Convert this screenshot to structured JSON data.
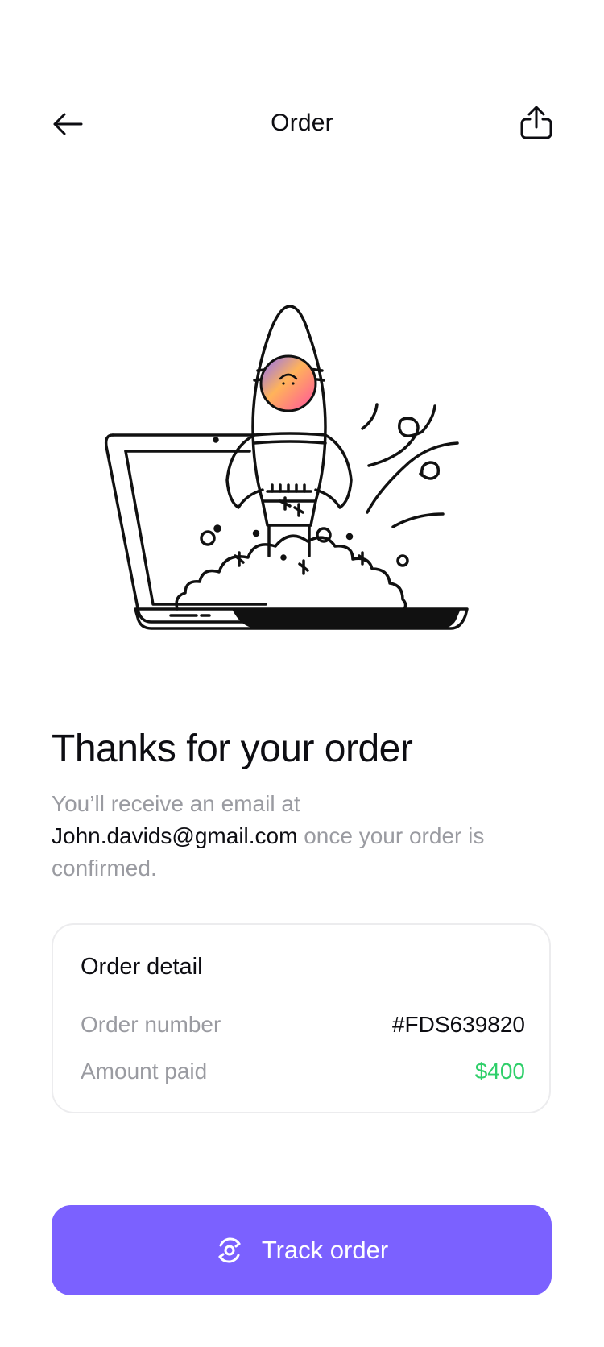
{
  "header": {
    "title": "Order",
    "back_icon": "arrow-left-icon",
    "share_icon": "share-icon"
  },
  "illustration": {
    "name": "rocket-launch-illustration"
  },
  "confirmation": {
    "heading": "Thanks for your order",
    "message_before": "You’ll receive an email at",
    "email": "John.davids@gmail.com",
    "message_after": "once your order is confirmed."
  },
  "order_detail": {
    "title": "Order detail",
    "order_number_label": "Order number",
    "order_number_value": "#FDS639820",
    "amount_paid_label": "Amount paid",
    "amount_paid_value": "$400"
  },
  "actions": {
    "track_label": "Track order",
    "track_icon": "track-orbit-icon"
  },
  "colors": {
    "accent": "#7b61ff",
    "success": "#2fcf6a",
    "muted_text": "#9a9ba1",
    "primary_text": "#0d0d12"
  }
}
